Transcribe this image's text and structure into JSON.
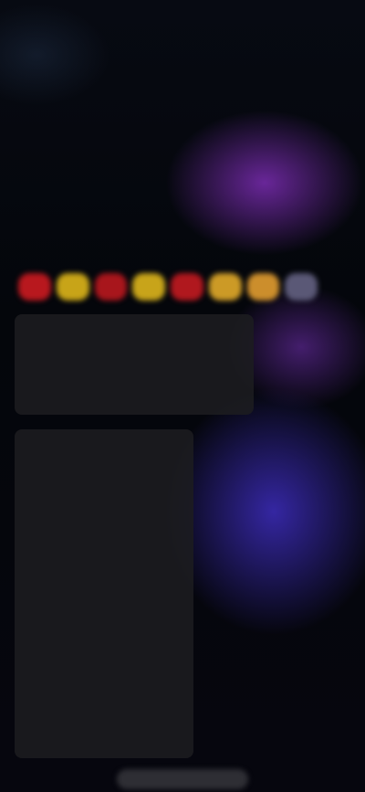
{
  "palette": [
    {
      "name": "red",
      "color": "#b8181e"
    },
    {
      "name": "yellow",
      "color": "#c8a418"
    },
    {
      "name": "red",
      "color": "#a8161c"
    },
    {
      "name": "yellow",
      "color": "#c8a41a"
    },
    {
      "name": "red",
      "color": "#b0181e"
    },
    {
      "name": "orange",
      "color": "#cc9a26"
    },
    {
      "name": "orange",
      "color": "#cc8e2c"
    },
    {
      "name": "grey",
      "color": "#5a5876"
    }
  ],
  "summary_rows": [
    {
      "label": "",
      "value": ""
    },
    {
      "label": "",
      "value": ""
    },
    {
      "label": "",
      "value": ""
    }
  ],
  "detail_rows": [
    {
      "label": "",
      "value": ""
    },
    {
      "label": "",
      "value": ""
    },
    {
      "label": "",
      "value": ""
    },
    {
      "label": "",
      "value": ""
    },
    {
      "label": "",
      "value": ""
    },
    {
      "label": "",
      "value": ""
    },
    {
      "label": "",
      "value": ""
    },
    {
      "label": "",
      "value": ""
    },
    {
      "label": "",
      "value": ""
    },
    {
      "label": "",
      "value": ""
    },
    {
      "label": "",
      "value": ""
    },
    {
      "label": "",
      "value": ""
    }
  ],
  "colors": {
    "accent_purple": "#6e28a0",
    "accent_blue": "#3728aa",
    "warning": "#c0493c",
    "panel": "#1c1c20"
  }
}
